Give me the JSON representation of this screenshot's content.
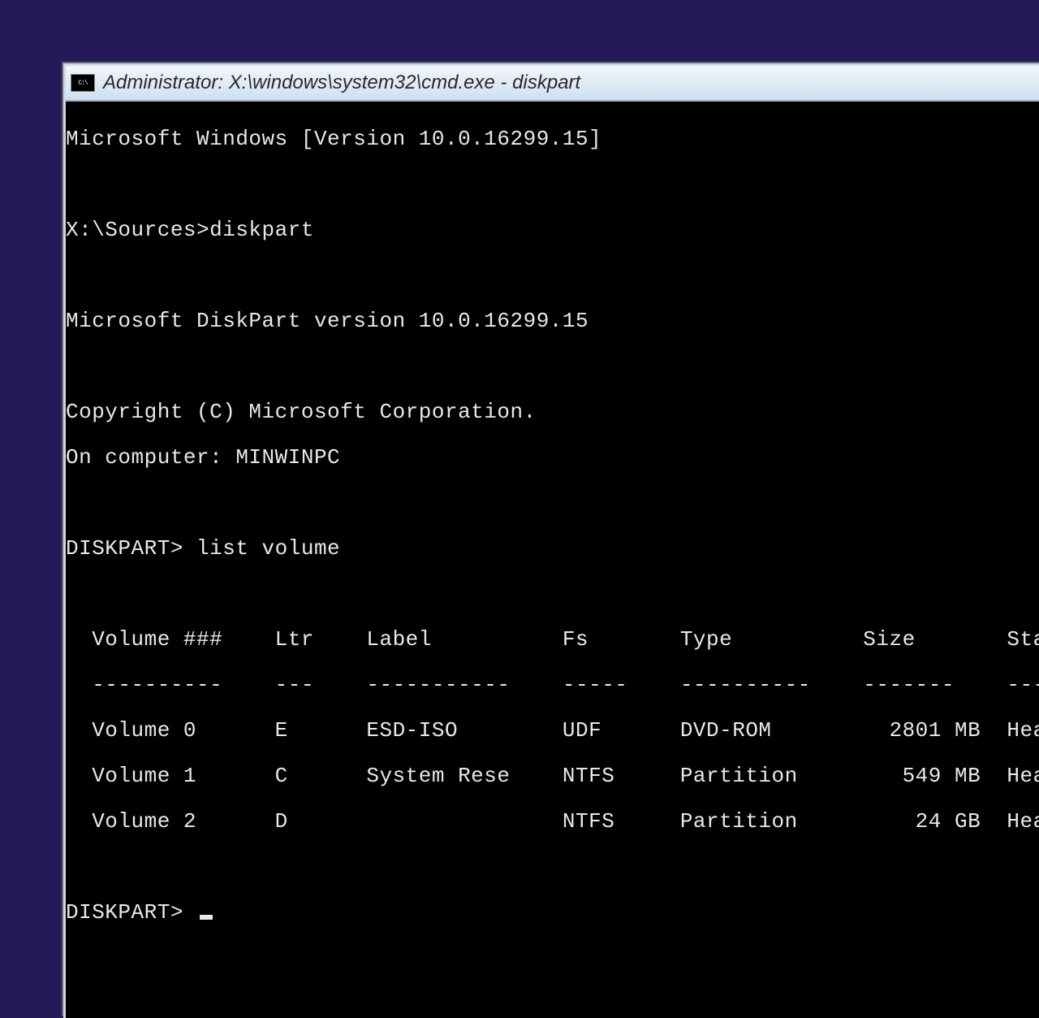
{
  "window": {
    "title": "Administrator: X:\\windows\\system32\\cmd.exe - diskpart",
    "sys_icon_label": "C:\\"
  },
  "console": {
    "banner_version": "Microsoft Windows [Version 10.0.16299.15]",
    "first_prompt": "X:\\Sources>diskpart",
    "diskpart_version": "Microsoft DiskPart version 10.0.16299.15",
    "copyright": "Copyright (C) Microsoft Corporation.",
    "on_computer": "On computer: MINWINPC",
    "cmd_prompt1": "DISKPART> list volume",
    "table": {
      "headers": {
        "volume": "Volume ###",
        "ltr": "Ltr",
        "label": "Label",
        "fs": "Fs",
        "type": "Type",
        "size": "Size",
        "status": "Statu"
      },
      "dashes": {
        "volume": "----------",
        "ltr": "---",
        "label": "-----------",
        "fs": "-----",
        "type": "----------",
        "size": "-------",
        "status": "------"
      },
      "rows": [
        {
          "volume": "Volume 0",
          "ltr": "E",
          "label": "ESD-ISO",
          "fs": "UDF",
          "type": "DVD-ROM",
          "size": "2801 MB",
          "status": "Healt"
        },
        {
          "volume": "Volume 1",
          "ltr": "C",
          "label": "System Rese",
          "fs": "NTFS",
          "type": "Partition",
          "size": "549 MB",
          "status": "Healt"
        },
        {
          "volume": "Volume 2",
          "ltr": "D",
          "label": "",
          "fs": "NTFS",
          "type": "Partition",
          "size": "24 GB",
          "status": "Healt"
        }
      ]
    },
    "cmd_prompt2": "DISKPART> "
  }
}
